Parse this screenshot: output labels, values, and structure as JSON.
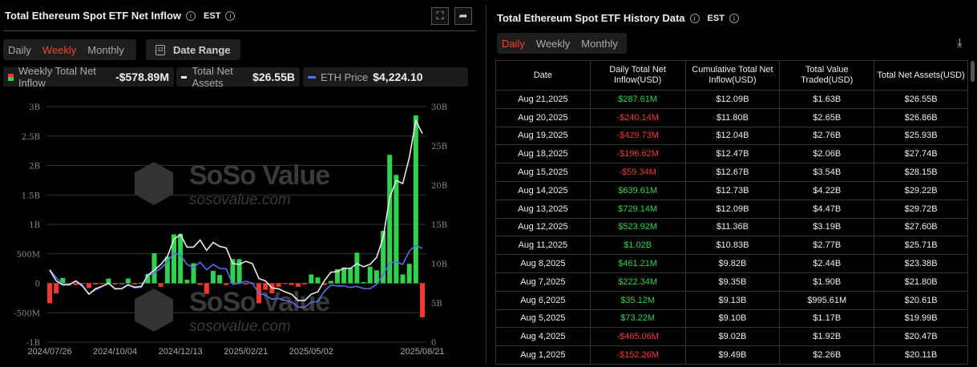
{
  "left": {
    "title": "Total Ethereum Spot ETF Net Inflow",
    "tz": "EST",
    "tabs": [
      "Daily",
      "Weekly",
      "Monthly"
    ],
    "active_tab": "Weekly",
    "date_range": "Date Range",
    "legend": [
      {
        "label": "Weekly Total Net Inflow",
        "value": "-$578.89M"
      },
      {
        "label": "Total Net Assets",
        "value": "$26.55B"
      },
      {
        "label": "ETH Price",
        "value": "$4,224.10"
      }
    ]
  },
  "watermark": {
    "brand": "SoSo Value",
    "url": "sosovalue.com"
  },
  "chart_data": {
    "type": "bar",
    "title": "Total Ethereum Spot ETF Net Inflow",
    "x_ticks": [
      "2024/07/26",
      "2024/10/04",
      "2024/12/13",
      "2025/02/21",
      "2025/05/02",
      "2025/08/21"
    ],
    "x_tick_index": [
      0,
      10,
      20,
      30,
      40,
      57
    ],
    "y_left_ticks": [
      "3B",
      "2.5B",
      "2B",
      "1.5B",
      "1B",
      "500M",
      "0",
      "-500M",
      "-1B"
    ],
    "ylim_left": [
      -1,
      3
    ],
    "y_right_ticks": [
      "30B",
      "25B",
      "20B",
      "15B",
      "10B",
      "5B",
      "0"
    ],
    "ylim_right": [
      0,
      30
    ],
    "colors": {
      "positive": "#2fd14e",
      "negative": "#f03a30",
      "assets": "#e8e8e8",
      "price": "#5470e8"
    },
    "series": [
      {
        "name": "Weekly Total Net Inflow (B USD)",
        "values": [
          -0.34,
          -0.17,
          0.09,
          -0.01,
          -0.03,
          -0.01,
          -0.08,
          -0.02,
          -0.01,
          0.08,
          -0.02,
          0,
          0.08,
          -0.02,
          0.01,
          0.16,
          0.51,
          -0.06,
          0.45,
          0.83,
          0.84,
          0.06,
          0.34,
          -0.03,
          -0.18,
          0.21,
          0.14,
          -0.03,
          0.41,
          0.41,
          -0.02,
          -0.01,
          -0.34,
          -0.11,
          -0.17,
          -0.06,
          -0.01,
          -0.03,
          -0.06,
          -0.02,
          0.15,
          0.1,
          -0.03,
          0.04,
          0.24,
          0.27,
          0.26,
          0.52,
          0.02,
          0.28,
          0.22,
          0.89,
          2.18,
          1.84,
          0.15,
          0.33,
          2.85,
          -0.579
        ]
      },
      {
        "name": "Total Net Assets (B USD)",
        "values": [
          9.2,
          7.8,
          7.3,
          7.3,
          7.8,
          7.2,
          6.1,
          6.8,
          7.1,
          7.5,
          6.8,
          6.8,
          7.3,
          7.0,
          7.1,
          8.5,
          9.2,
          9.9,
          10.9,
          13.1,
          13.7,
          12.1,
          12.1,
          13.0,
          11.7,
          12.7,
          12.2,
          12.0,
          10.0,
          9.9,
          10.3,
          10.0,
          8.1,
          7.8,
          6.9,
          6.8,
          6.4,
          6.1,
          5.3,
          5.3,
          6.1,
          6.4,
          7.8,
          8.9,
          9.0,
          9.4,
          9.4,
          10.0,
          9.6,
          9.9,
          10.8,
          13.3,
          18.4,
          20.6,
          20.2,
          23.5,
          28.2,
          26.55
        ]
      },
      {
        "name": "ETH Price (USD)",
        "values": [
          3260,
          2900,
          2600,
          2600,
          2750,
          2510,
          2170,
          2350,
          2510,
          2650,
          2390,
          2410,
          2600,
          2440,
          2470,
          2960,
          3140,
          3320,
          3620,
          4010,
          3920,
          3500,
          3360,
          3600,
          3260,
          3500,
          3320,
          3300,
          2600,
          2650,
          2740,
          2650,
          2200,
          2110,
          1930,
          1970,
          1870,
          1810,
          1570,
          1570,
          1790,
          1830,
          2290,
          2570,
          2530,
          2530,
          2460,
          2510,
          2410,
          2410,
          2600,
          3040,
          3560,
          3620,
          3500,
          4100,
          4370,
          4224.1
        ]
      }
    ]
  },
  "right": {
    "title": "Total Ethereum Spot ETF History Data",
    "tz": "EST",
    "tabs": [
      "Daily",
      "Weekly",
      "Monthly"
    ],
    "active_tab": "Daily",
    "columns": [
      "Date",
      "Daily Total Net Inflow(USD)",
      "Cumulative Total Net Inflow(USD)",
      "Total Value Traded(USD)",
      "Total Net Assets(USD)"
    ],
    "rows": [
      [
        "Aug 21,2025",
        "$287.61M",
        "$12.09B",
        "$1.63B",
        "$26.55B"
      ],
      [
        "Aug 20,2025",
        "-$240.14M",
        "$11.80B",
        "$2.65B",
        "$26.86B"
      ],
      [
        "Aug 19,2025",
        "-$429.73M",
        "$12.04B",
        "$2.76B",
        "$25.93B"
      ],
      [
        "Aug 18,2025",
        "-$196.62M",
        "$12.47B",
        "$2.06B",
        "$27.74B"
      ],
      [
        "Aug 15,2025",
        "-$59.34M",
        "$12.67B",
        "$3.54B",
        "$28.15B"
      ],
      [
        "Aug 14,2025",
        "$639.61M",
        "$12.73B",
        "$4.22B",
        "$29.22B"
      ],
      [
        "Aug 13,2025",
        "$729.14M",
        "$12.09B",
        "$4.47B",
        "$29.72B"
      ],
      [
        "Aug 12,2025",
        "$523.92M",
        "$11.36B",
        "$3.19B",
        "$27.60B"
      ],
      [
        "Aug 11,2025",
        "$1.02B",
        "$10.83B",
        "$2.77B",
        "$25.71B"
      ],
      [
        "Aug 8,2025",
        "$461.21M",
        "$9.82B",
        "$2.44B",
        "$23.38B"
      ],
      [
        "Aug 7,2025",
        "$222.34M",
        "$9.35B",
        "$1.90B",
        "$21.80B"
      ],
      [
        "Aug 6,2025",
        "$35.12M",
        "$9.13B",
        "$995.61M",
        "$20.61B"
      ],
      [
        "Aug 5,2025",
        "$73.22M",
        "$9.10B",
        "$1.17B",
        "$19.99B"
      ],
      [
        "Aug 4,2025",
        "-$465.06M",
        "$9.02B",
        "$1.92B",
        "$20.47B"
      ],
      [
        "Aug 1,2025",
        "-$152.26M",
        "$9.49B",
        "$2.26B",
        "$20.11B"
      ]
    ]
  }
}
